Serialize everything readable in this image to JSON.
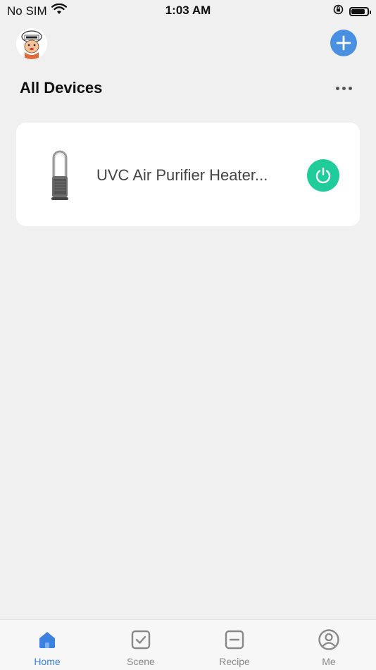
{
  "status_bar": {
    "carrier": "No SIM",
    "time": "1:03 AM",
    "battery_level": 0.85
  },
  "header": {
    "title": "All Devices",
    "avatar_icon": "chef-avatar-icon",
    "add_icon": "plus-icon",
    "more_icon": "more-dots-icon"
  },
  "devices": [
    {
      "name": "UVC Air Purifier Heater...",
      "image_icon": "air-purifier-tower-icon",
      "power_icon": "power-icon",
      "power_color": "#1fcc9a"
    }
  ],
  "tabs": [
    {
      "label": "Home",
      "icon": "home-icon",
      "active": true
    },
    {
      "label": "Scene",
      "icon": "checkbox-icon",
      "active": false
    },
    {
      "label": "Recipe",
      "icon": "minus-square-icon",
      "active": false
    },
    {
      "label": "Me",
      "icon": "user-circle-icon",
      "active": false
    }
  ],
  "colors": {
    "accent": "#4a90e2",
    "tab_active": "#3b82e0",
    "tab_inactive": "#888888",
    "background": "#f0f0f0"
  }
}
